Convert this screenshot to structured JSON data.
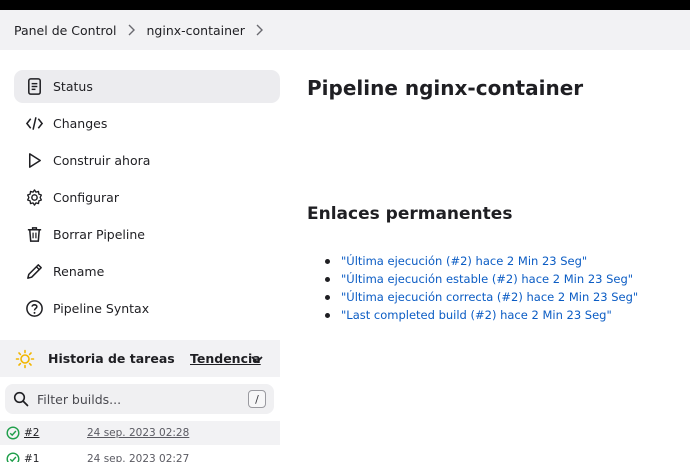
{
  "breadcrumb": {
    "items": [
      "Panel de Control",
      "nginx-container"
    ]
  },
  "sidebar": {
    "items": [
      {
        "label": "Status",
        "icon": "document-icon",
        "active": true
      },
      {
        "label": "Changes",
        "icon": "code-icon"
      },
      {
        "label": "Construir ahora",
        "icon": "play-icon"
      },
      {
        "label": "Configurar",
        "icon": "gear-icon"
      },
      {
        "label": "Borrar Pipeline",
        "icon": "trash-icon"
      },
      {
        "label": "Rename",
        "icon": "pencil-icon"
      },
      {
        "label": "Pipeline Syntax",
        "icon": "help-circle-icon"
      }
    ]
  },
  "history": {
    "title": "Historia de tareas",
    "trend_label": "Tendencia",
    "filter_placeholder": "Filter builds...",
    "filter_shortcut": "/",
    "builds": [
      {
        "number": "#2",
        "date": "24 sep. 2023 02:28",
        "status": "success"
      },
      {
        "number": "#1",
        "date": "24 sep. 2023 02:27",
        "status": "success"
      }
    ]
  },
  "main": {
    "title": "Pipeline nginx-container",
    "permalinks_title": "Enlaces permanentes",
    "permalinks": [
      "\"Última ejecución (#2) hace 2 Min 23 Seg\"",
      "\"Última ejecución estable (#2) hace 2 Min 23 Seg\"",
      "\"Última ejecución correcta (#2) hace 2 Min 23 Seg\"",
      "\"Last completed build (#2) hace 2 Min 23 Seg\""
    ]
  },
  "colors": {
    "link": "#0b5cc4",
    "success": "#1e9e4a",
    "sun": "#f2b600",
    "active_bg": "#ececef"
  }
}
